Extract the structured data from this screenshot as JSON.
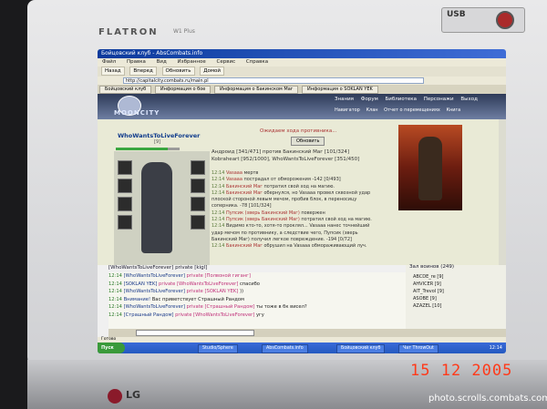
{
  "monitor": {
    "brand": "FLATRON",
    "brand_sub": "W1 Plus",
    "sticker": "USB",
    "logo": "LG"
  },
  "photo": {
    "date_stamp": "15 12 2005",
    "credit": "photo.scrolls.combats.com",
    "colors": {
      "date": "#ff3a1a"
    }
  },
  "browser": {
    "title": "Бойцовский клуб - AbsCombats.info",
    "menu": [
      "Файл",
      "Правка",
      "Вид",
      "Избранное",
      "Сервис",
      "Справка"
    ],
    "toolbar": [
      "Назад",
      "Вперед",
      "Обновить",
      "Домой"
    ],
    "address": "http://capitalcity.combats.ru/main.pl",
    "tabs": [
      "Бойцовский клуб",
      "Информация о бое",
      "Информация о Бакинском Маг",
      "Информация о SOKLAN YEK"
    ]
  },
  "game": {
    "logo": "MOONCITY",
    "nav": [
      "Знания",
      "Форум",
      "Библиотека",
      "Персонажи",
      "Выход"
    ],
    "nav2": [
      "Навигатор",
      "Клан",
      "Отчет о перемещениях",
      "Книга"
    ],
    "player_name": "WhoWantsToLiveForever",
    "player_level": "[9]",
    "hp_fraction": 0.82,
    "waiting_text": "Ожидаем хода противника...",
    "refresh_label": "Обновить",
    "battle_line": "Андроид [341/471] против Бакинский Маг [101/324]",
    "battle_line2": "Kobraheart [952/1000], WhoWantsToLiveForever [351/450]",
    "log": [
      {
        "t": "12:14",
        "n": "Vasaaa",
        "m": "мертв"
      },
      {
        "t": "12:14",
        "n": "Vasaaa",
        "m": "пострадал от обморожения -142 [0/493]"
      },
      {
        "t": "12:14",
        "n": "Бакинский Маг",
        "m": "потратил свой ход на магию."
      },
      {
        "t": "12:14",
        "n": "Бакинский Маг",
        "m": "обернулся, но Vasaaa провел сквозной удар"
      },
      {
        "t": "",
        "n": "",
        "m": "плоской стороной левым мечом, пробив блок, в переносицу"
      },
      {
        "t": "",
        "n": "",
        "m": "соперника. -78 [101/324]"
      },
      {
        "t": "12:14",
        "n": "Пупсик (зверь Бакинский Маг)",
        "m": "повержен"
      },
      {
        "t": "12:14",
        "n": "Пупсик (зверь Бакинский Маг)",
        "m": "потратил свой ход на магию."
      },
      {
        "t": "12:14",
        "n": "",
        "m": "Видимо кто-то, хотя-то проклял... Vasaaa нанес точнейший"
      },
      {
        "t": "",
        "n": "",
        "m": "удар мечом по противнику, а следствие чего, Пупсик (зверь"
      },
      {
        "t": "",
        "n": "",
        "m": "Бакинский Маг) получил легкое повреждение. -194 [0/72]"
      },
      {
        "t": "12:14",
        "n": "Бакинский Маг",
        "m": "обрушил на Vasaaa обмораживающий луч."
      }
    ],
    "chat_header": "[WhoWantsToLiveForever] private [kigl]",
    "chat": [
      {
        "ts": "12:14",
        "nm": "[WhoWantsToLiveForever]",
        "pr": "private [Полвоной гиганг]",
        "msg": ""
      },
      {
        "ts": "12:14",
        "nm": "[SOKLAN YEK]",
        "pr": "private [WhoWantsToLiveForever]",
        "msg": "спасибо"
      },
      {
        "ts": "12:14",
        "nm": "[WhoWantsToLiveForever]",
        "pr": "private [SOKLAN YEK]",
        "msg": "))"
      },
      {
        "ts": "12:14",
        "nm": "Внимание!",
        "pr": "",
        "msg": "Вас приветствует Страшный Рандом"
      },
      {
        "ts": "12:14",
        "nm": "[WhoWantsToLiveForever]",
        "pr": "private [Страшный Рандом]",
        "msg": "ты тоже в бк висел?"
      },
      {
        "ts": "12:14",
        "nm": "[Страшный Рандом]",
        "pr": "private [WhoWantsToLiveForever]",
        "msg": "угу"
      }
    ],
    "online_header": "Зал воинов (249)",
    "online": [
      "ABCDE_re [9]",
      "AHVICER [9]",
      "AIT_Trevol [9]",
      "ASOBE [9]",
      "AZAZEL [10]"
    ],
    "status": "Готово",
    "taskbar": {
      "start": "Пуск",
      "items": [
        "Studio/Sphere",
        "AbsCombats.info",
        "Бойцовский клуб",
        "Чат ThrowOut"
      ],
      "clock": "12:14"
    }
  }
}
